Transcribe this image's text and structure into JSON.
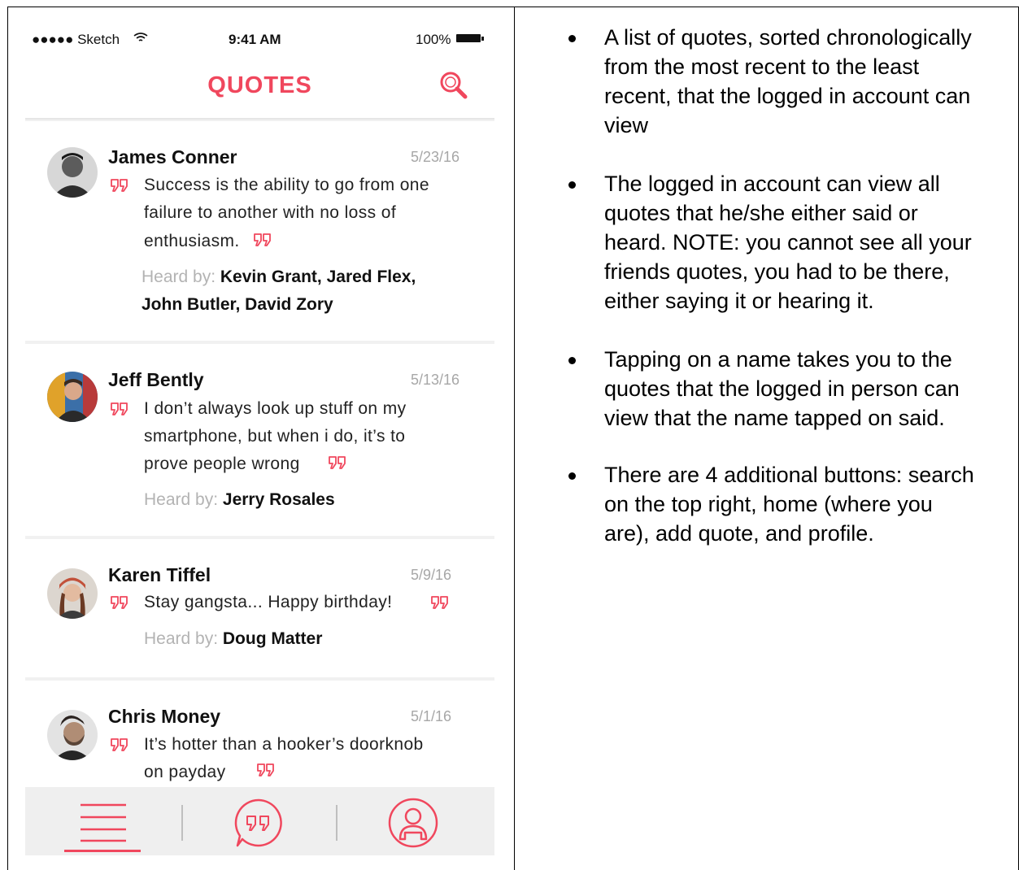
{
  "phone": {
    "status_bar": {
      "carrier": "●●●●● Sketch",
      "time": "9:41 AM",
      "battery": "100%"
    },
    "header": {
      "title": "QUOTES"
    },
    "quotes": [
      {
        "name": "James Conner",
        "date": "5/23/16",
        "quote_lines": [
          "Success is the ability to go from one",
          "failure to another with no loss of",
          "enthusiasm."
        ],
        "heard_label": "Heard by:",
        "heard_names_lines": [
          "Kevin Grant, Jared Flex,",
          "John Butler, David Zory"
        ]
      },
      {
        "name": "Jeff Bently",
        "date": "5/13/16",
        "quote_lines": [
          "I don’t always look up stuff on my",
          "smartphone, but when i do, it’s to",
          "prove people wrong"
        ],
        "heard_label": "Heard by:",
        "heard_names_lines": [
          "Jerry Rosales"
        ]
      },
      {
        "name": "Karen Tiffel",
        "date": "5/9/16",
        "quote_lines": [
          "Stay gangsta... Happy birthday!"
        ],
        "heard_label": "Heard by:",
        "heard_names_lines": [
          "Doug Matter"
        ]
      },
      {
        "name": "Chris Money",
        "date": "5/1/16",
        "quote_lines": [
          "It’s hotter than a hooker’s doorknob",
          "on payday"
        ],
        "heard_label": "",
        "heard_names_lines": []
      }
    ],
    "tab_bar": {
      "tabs": [
        "home-icon",
        "add-quote-icon",
        "profile-icon"
      ],
      "active": "home-icon"
    },
    "colors": {
      "accent": "#f0475d",
      "background": "#f1f1f1",
      "date": "#a7a7a7"
    }
  },
  "notes": {
    "bullets": [
      [
        "A list of quotes, sorted chronologically",
        "from the most recent to the least",
        "recent, that the logged in account can",
        "view"
      ],
      [
        "The logged in account can view all",
        "quotes that he/she either said or",
        "heard. NOTE: you cannot see all your",
        "friends quotes, you had to be there,",
        "either saying it or hearing it."
      ],
      [
        "Tapping on a name takes you to the",
        "quotes that the logged in person can",
        "view that the name tapped on said."
      ],
      [
        "There are 4 additional buttons: search",
        "on the top right, home (where you",
        "are), add quote, and profile."
      ]
    ]
  }
}
